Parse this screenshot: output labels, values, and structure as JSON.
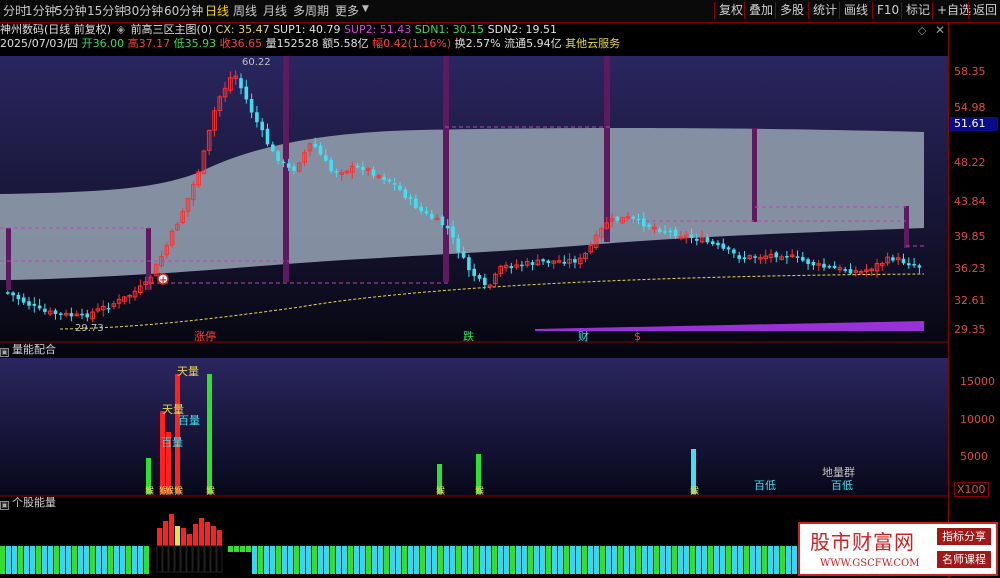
{
  "toolbar": {
    "left": [
      "分时",
      "1分钟",
      "5分钟",
      "15分钟",
      "30分钟",
      "60分钟",
      "日线",
      "周线",
      "月线",
      "多周期",
      "更多"
    ],
    "active": "日线",
    "right": [
      "复权",
      "叠加",
      "多股",
      "统计",
      "画线",
      "F10",
      "标记",
      "+自选",
      "返回"
    ]
  },
  "info": {
    "stock": "神州数码(日线 前复权)",
    "indicator_label": "前高三区主图(0)",
    "cx": "CX: 35.47",
    "sup1": "SUP1: 40.79",
    "sup2": "SUP2: 51.43",
    "sdn1": "SDN1: 30.15",
    "sdn2": "SDN2: 19.51",
    "date": "2025/07/03/四",
    "open": "开36.00",
    "high": "高37.17",
    "low": "低35.93",
    "close": "收36.65",
    "volume": "量152528",
    "amount": "额5.58亿",
    "change": "幅0.42(1.16%)",
    "turnover": "换2.57%",
    "float": "流通5.94亿",
    "cloud": "其他云服务"
  },
  "price_axis": [
    "58.35",
    "54.98",
    "51.61",
    "48.22",
    "43.84",
    "39.85",
    "36.23",
    "32.61",
    "29.35"
  ],
  "current_price_tag": "51.61",
  "chart_labels": {
    "high_mark": "60.22",
    "low_mark": "29.73",
    "signal_zhangting": "涨停",
    "signal_die": "跌",
    "signal_cai": "财",
    "signal_dollar": "$"
  },
  "volume_panel": {
    "title": "量能配合",
    "axis": [
      "15000",
      "10000",
      "5000"
    ],
    "x100": "X100",
    "labels": [
      "天量",
      "天量",
      "百量",
      "百量",
      "百低",
      "地量群",
      "百低"
    ],
    "markers": "猴"
  },
  "energy_panel": {
    "title": "个股能量"
  },
  "watermark": {
    "title": "股市财富网",
    "url": "WWW.GSCFW.COM",
    "tag1": "指标分享",
    "tag2": "名师课程"
  },
  "colors": {
    "up": "#ff3030",
    "down": "#40e0f0",
    "band": "#8a96a8",
    "purple": "#6a1f6a",
    "green": "#30e030",
    "yellow": "#e8d84a"
  }
}
